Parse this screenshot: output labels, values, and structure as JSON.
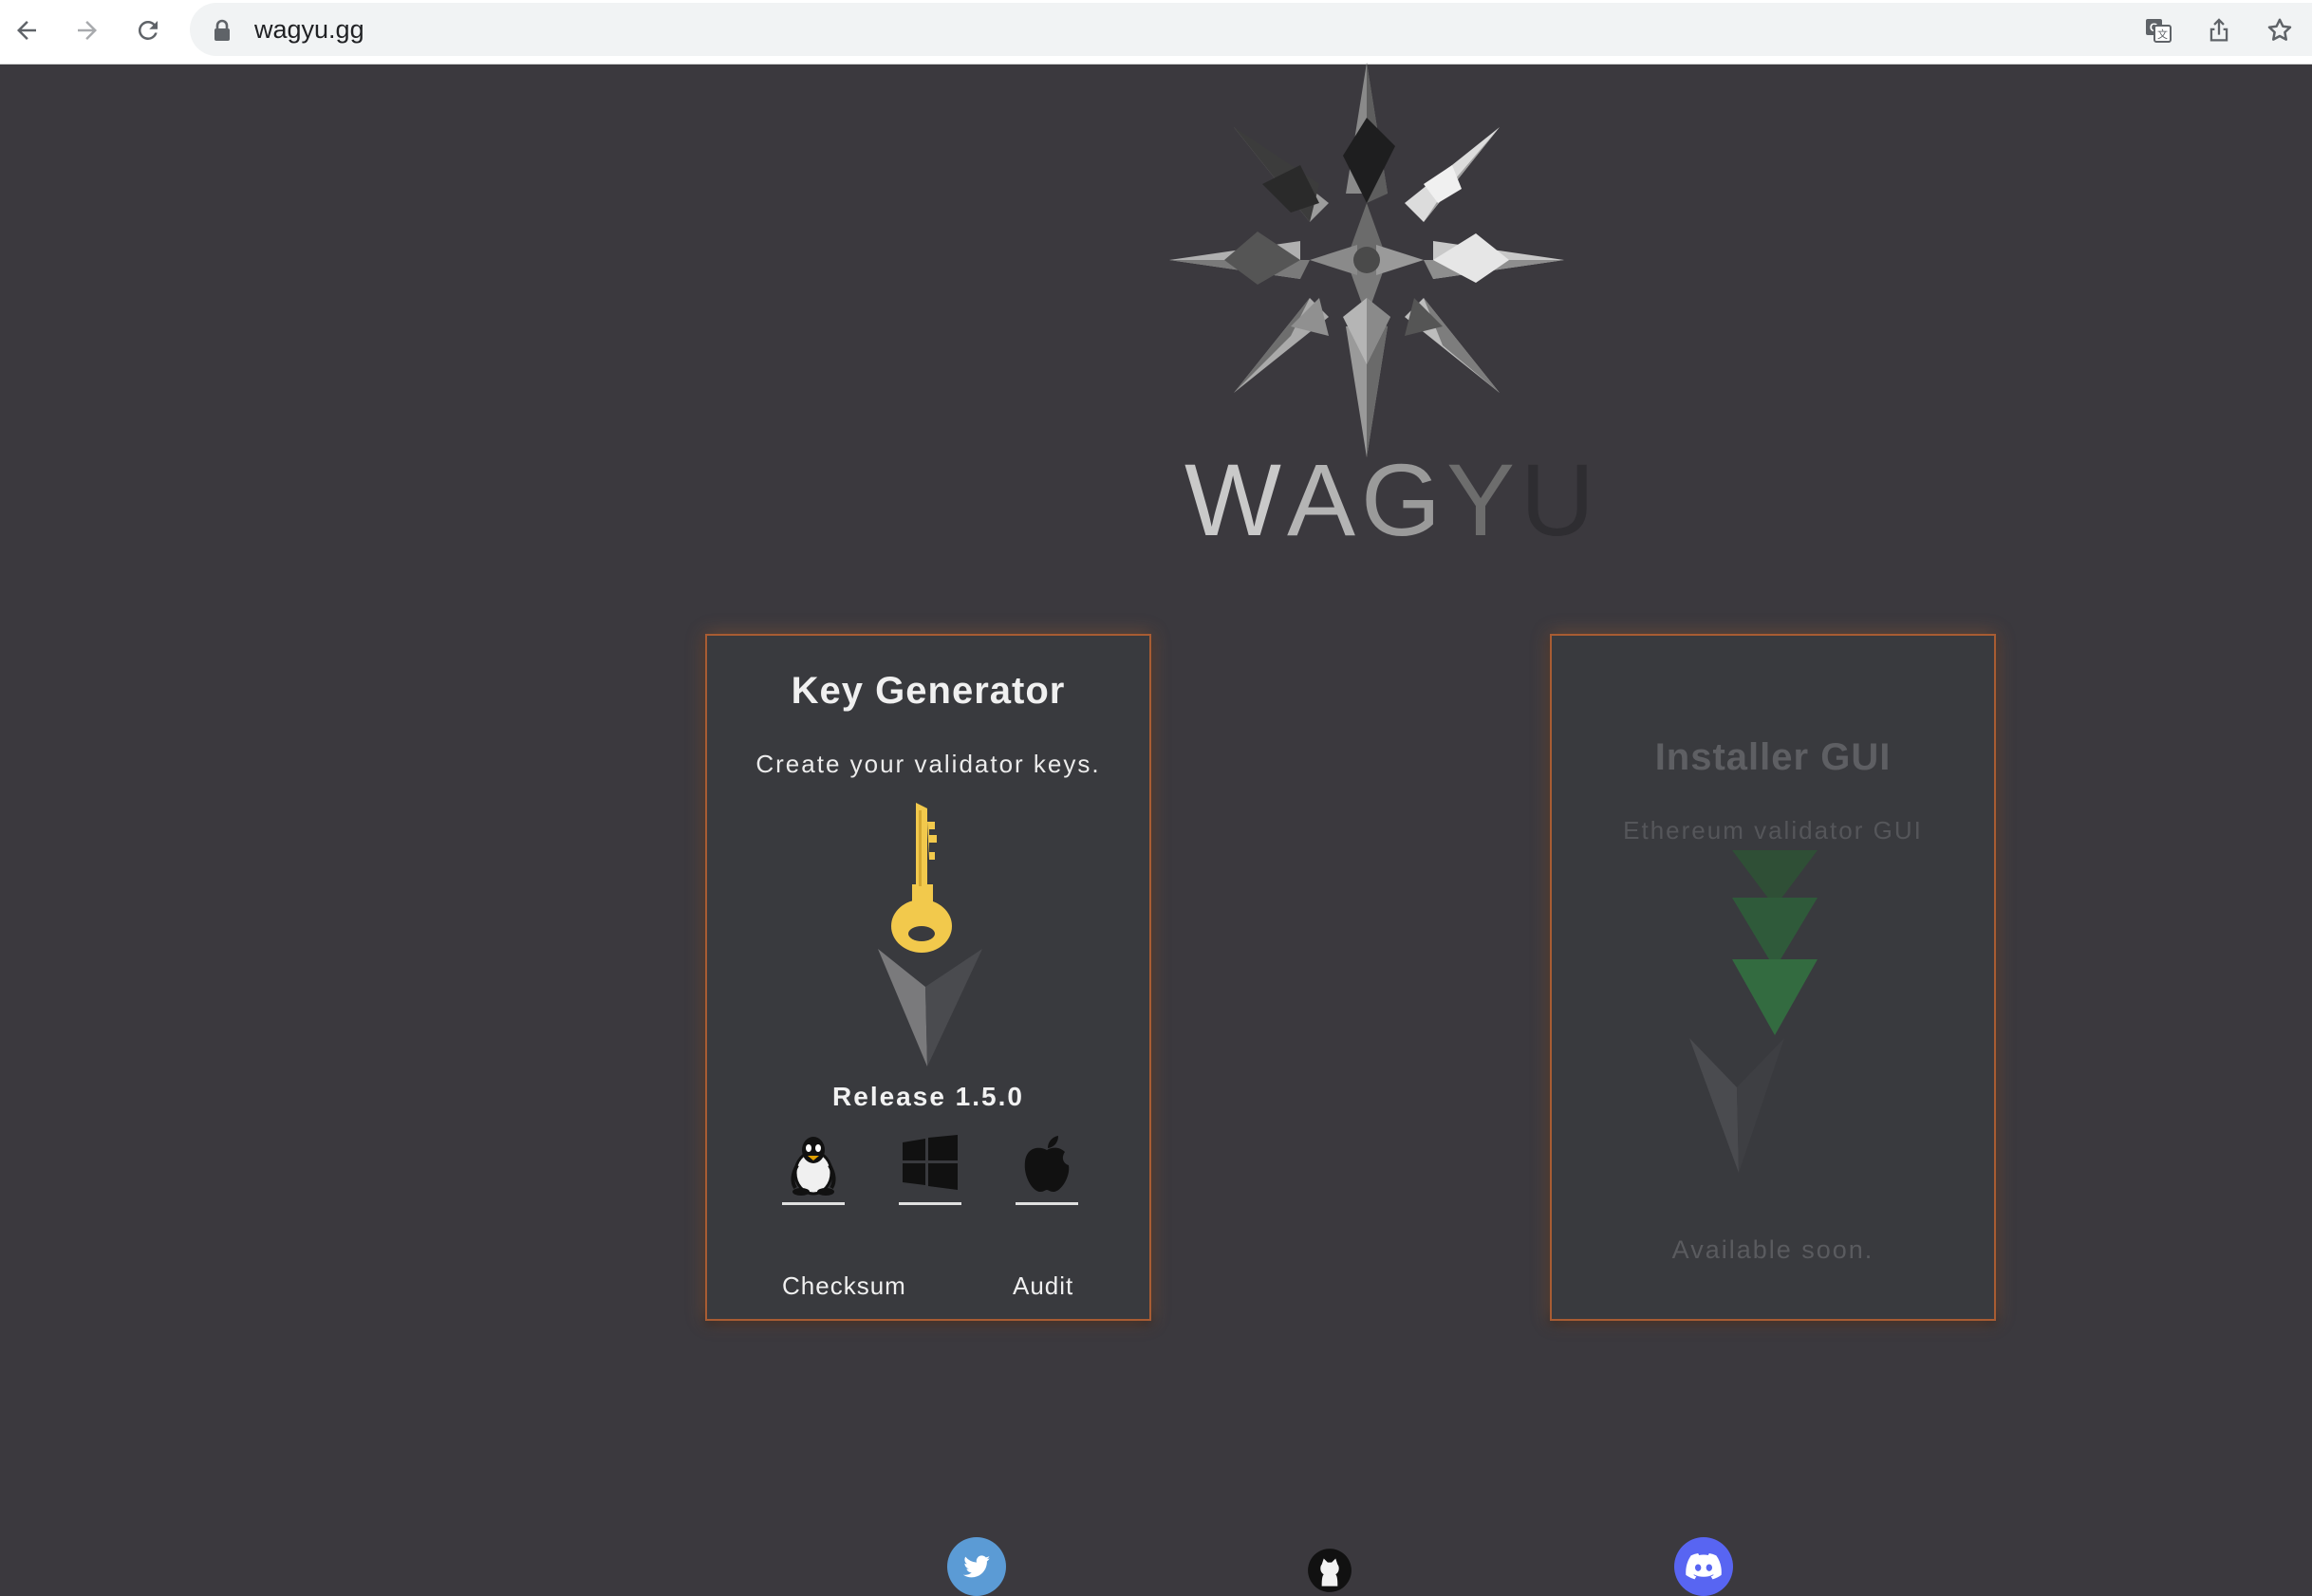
{
  "browser": {
    "url": "wagyu.gg",
    "icons": {
      "back": "arrow-left-icon",
      "forward": "arrow-right-icon",
      "reload": "reload-icon",
      "lock": "lock-icon",
      "translate": "translate-icon",
      "share": "share-icon",
      "bookmark": "star-icon"
    }
  },
  "brand": {
    "letters": [
      "W",
      "A",
      "G",
      "Y",
      "U"
    ]
  },
  "cards": {
    "key_generator": {
      "title": "Key Generator",
      "subtitle": "Create your validator keys.",
      "release": "Release 1.5.0",
      "downloads": [
        "linux-icon",
        "windows-icon",
        "apple-icon"
      ],
      "links": {
        "checksum": "Checksum",
        "audit": "Audit"
      }
    },
    "installer_gui": {
      "title": "Installer GUI",
      "subtitle": "Ethereum validator GUI",
      "footer": "Available soon."
    }
  },
  "social": [
    "twitter-icon",
    "github-icon",
    "discord-icon"
  ],
  "colors": {
    "page_bg": "#3b393e",
    "card_bg": "#393a3e",
    "card_border_glow": "#a85c33",
    "key_yellow": "#f2c94c",
    "gui_green": "#2f5a3a",
    "twitter": "#5b9bd5",
    "discord": "#5865f2"
  }
}
